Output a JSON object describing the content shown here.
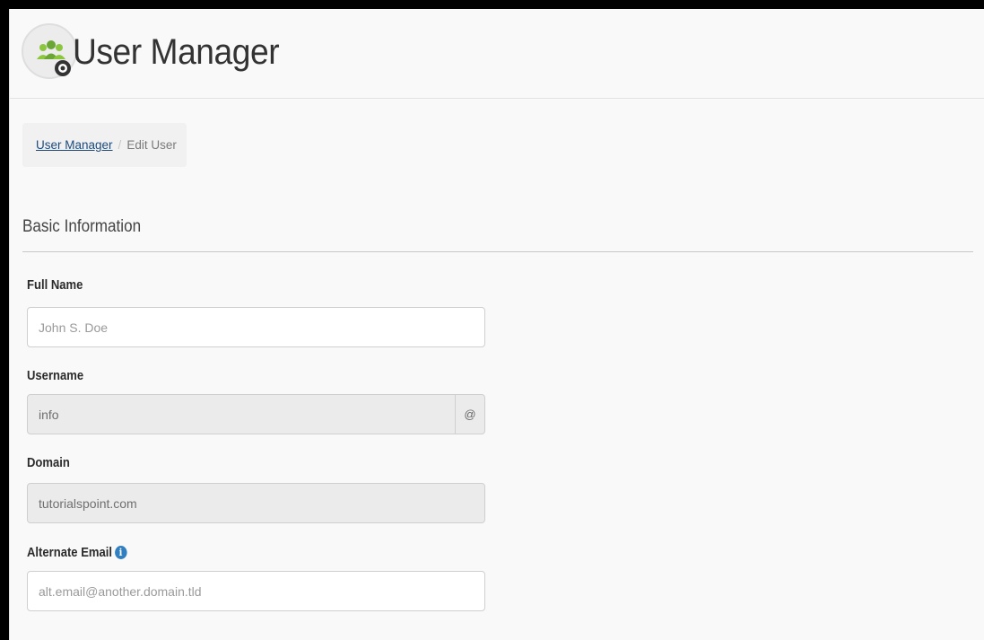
{
  "header": {
    "title": "User Manager",
    "icon": "user-manager-icon"
  },
  "breadcrumb": {
    "parent_label": "User Manager",
    "separator": "/",
    "current_label": "Edit User"
  },
  "section": {
    "title": "Basic Information"
  },
  "form": {
    "full_name": {
      "label": "Full Name",
      "value": "",
      "placeholder": "John S. Doe"
    },
    "username": {
      "label": "Username",
      "value": "info",
      "addon": "@"
    },
    "domain": {
      "label": "Domain",
      "value": "tutorialspoint.com"
    },
    "alternate_email": {
      "label": "Alternate Email",
      "info_icon": "i",
      "value": "",
      "placeholder": "alt.email@another.domain.tld"
    }
  },
  "colors": {
    "link": "#1c4a7d",
    "info_icon": "#2f7fc1",
    "readonly_bg": "#ebebeb"
  }
}
